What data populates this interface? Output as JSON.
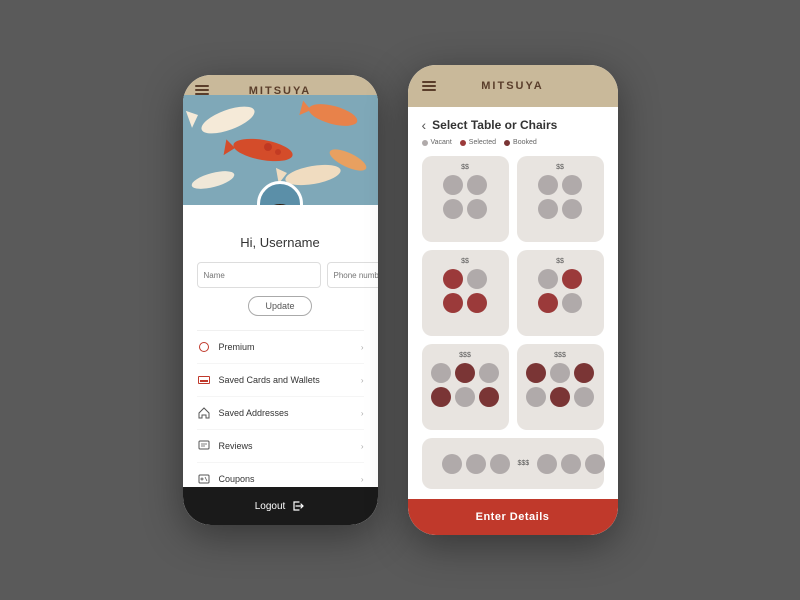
{
  "background": "#5a5a5a",
  "left_phone": {
    "header_title": "MITSUYA",
    "greeting": "Hi, Username",
    "name_placeholder": "Name",
    "phone_placeholder": "Phone number",
    "update_button": "Update",
    "menu_items": [
      {
        "id": "premium",
        "label": "Premium",
        "icon": "premium-icon"
      },
      {
        "id": "saved-cards",
        "label": "Saved Cards and Wallets",
        "icon": "card-icon"
      },
      {
        "id": "saved-addresses",
        "label": "Saved Addresses",
        "icon": "home-icon"
      },
      {
        "id": "reviews",
        "label": "Reviews",
        "icon": "review-icon"
      },
      {
        "id": "coupons",
        "label": "Coupons",
        "icon": "coupon-icon"
      }
    ],
    "logout_button": "Logout"
  },
  "right_phone": {
    "header_title": "MITSUYA",
    "page_title": "Select Table or Chairs",
    "back_label": "‹",
    "legend": [
      {
        "label": "Vacant",
        "color": "#b0aaaa"
      },
      {
        "label": "Selected",
        "color": "#9b3a3a"
      },
      {
        "label": "Booked",
        "color": "#7a3535"
      }
    ],
    "tables": [
      {
        "id": "table-1",
        "price": "$$",
        "cols": 2,
        "chairs": [
          "vacant",
          "vacant",
          "vacant",
          "vacant"
        ]
      },
      {
        "id": "table-2",
        "price": "$$",
        "cols": 2,
        "chairs": [
          "vacant",
          "vacant",
          "vacant",
          "vacant"
        ]
      },
      {
        "id": "table-3",
        "price": "$$",
        "cols": 2,
        "chairs": [
          "selected",
          "vacant",
          "selected",
          "selected"
        ]
      },
      {
        "id": "table-4",
        "price": "$$",
        "cols": 2,
        "chairs": [
          "vacant",
          "selected",
          "selected",
          "vacant"
        ]
      },
      {
        "id": "table-5",
        "price": "$$$",
        "cols": 3,
        "chairs": [
          "vacant",
          "booked",
          "vacant",
          "booked",
          "vacant",
          "booked"
        ]
      },
      {
        "id": "table-6",
        "price": "$$$",
        "cols": 3,
        "chairs": [
          "booked",
          "vacant",
          "booked",
          "vacant",
          "booked",
          "vacant"
        ]
      },
      {
        "id": "table-7",
        "price": "$$$",
        "cols": 3,
        "chairs": [
          "vacant",
          "vacant",
          "vacant",
          "vacant",
          "vacant",
          "vacant"
        ]
      }
    ],
    "enter_details_button": "Enter Details"
  }
}
